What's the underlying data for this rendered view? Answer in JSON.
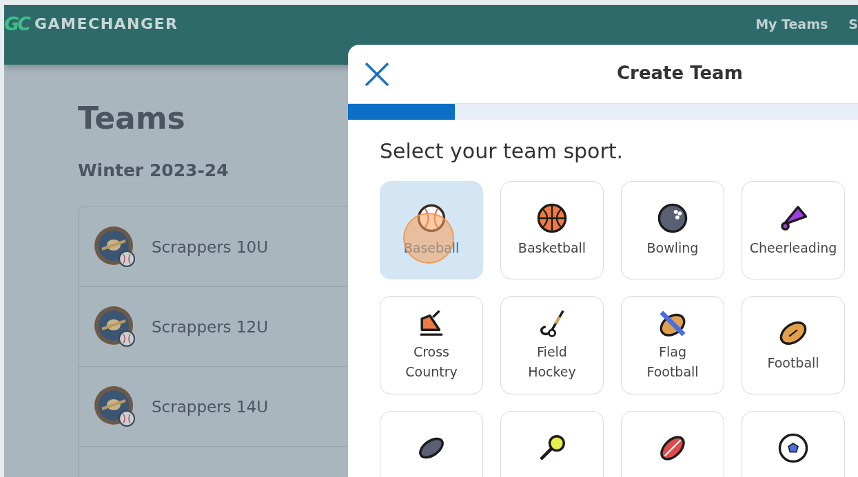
{
  "navbar": {
    "logo_mark": "GC",
    "brand": "GAMECHANGER",
    "links": [
      "My Teams",
      "S"
    ]
  },
  "page": {
    "title": "Teams",
    "season": "Winter 2023-24",
    "teams": [
      {
        "name": "Scrappers 10U"
      },
      {
        "name": "Scrappers 12U"
      },
      {
        "name": "Scrappers 14U"
      }
    ]
  },
  "modal": {
    "title": "Create Team",
    "progress": {
      "level": 0.21
    },
    "prompt": "Select your team sport.",
    "sports": [
      {
        "label": "Baseball",
        "selected": true
      },
      {
        "label": "Basketball",
        "selected": false
      },
      {
        "label": "Bowling",
        "selected": false
      },
      {
        "label": "Cheerleading",
        "selected": false
      },
      {
        "label": "Cross Country",
        "selected": false
      },
      {
        "label": "Field Hockey",
        "selected": false
      },
      {
        "label": "Flag Football",
        "selected": false
      },
      {
        "label": "Football",
        "selected": false
      },
      {
        "selected": false
      },
      {
        "selected": false
      },
      {
        "selected": false
      },
      {
        "selected": false
      }
    ]
  }
}
